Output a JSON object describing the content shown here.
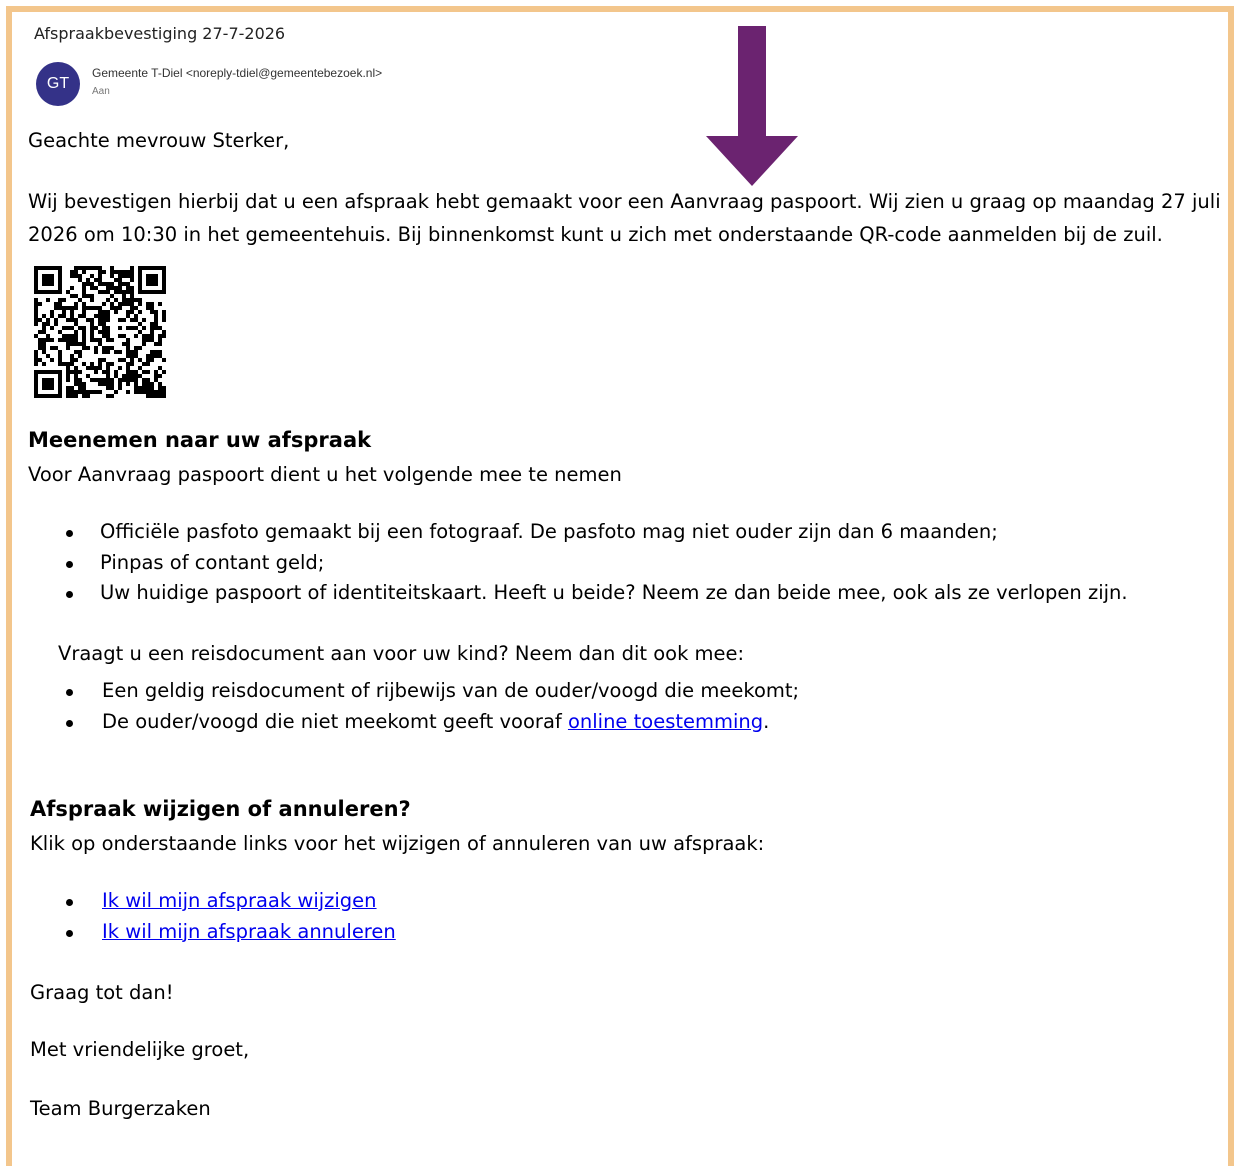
{
  "email": {
    "subject": "Afspraakbevestiging 27-7-2026",
    "avatar_initials": "GT",
    "sender": "Gemeente T-Diel <noreply-tdiel@gemeentebezoek.nl>",
    "to_label": "Aan"
  },
  "body": {
    "greeting": "Geachte mevrouw Sterker,",
    "intro_line1": "Wij bevestigen hierbij dat u een afspraak hebt gemaakt voor een Aanvraag paspoort. Wij zien u graag op maandag 27 juli",
    "intro_line2": "2026 om 10:30 in het gemeentehuis. Bij binnenkomst kunt u zich met onderstaande QR-code aanmelden bij de zuil.",
    "bring_heading": "Meenemen naar uw afspraak",
    "bring_intro": "Voor Aanvraag paspoort dient u het volgende mee te nemen",
    "bring_items": [
      "Officiële pasfoto gemaakt bij een fotograaf. De pasfoto mag niet ouder zijn dan 6 maanden;",
      "Pinpas of contant geld;",
      "Uw huidige paspoort of identiteitskaart. Heeft u beide? Neem ze dan beide mee, ook als ze verlopen zijn."
    ],
    "child_intro": "Vraagt u een reisdocument aan voor uw kind? Neem dan dit ook mee:",
    "child_item1": "Een geldig reisdocument of rijbewijs van de ouder/voogd die meekomt;",
    "child_item2_prefix": "De ouder/voogd die niet meekomt geeft vooraf ",
    "child_item2_link": "online toestemming",
    "child_item2_suffix": ".",
    "change_heading": "Afspraak wijzigen of annuleren?",
    "change_intro": "Klik op onderstaande links voor het wijzigen of annuleren van uw afspraak:",
    "change_link": "Ik wil mijn afspraak wijzigen",
    "cancel_link": "Ik wil mijn afspraak annuleren",
    "closing1": "Graag tot dan!",
    "closing2": "Met vriendelijke groet,",
    "signature": "Team Burgerzaken"
  },
  "colors": {
    "frame": "#f3c68c",
    "avatar": "#343288",
    "arrow": "#6b2370",
    "link": "#0000ee"
  },
  "icons": {
    "annotation_arrow": "down-arrow-icon",
    "qr": "qr-code-icon"
  }
}
